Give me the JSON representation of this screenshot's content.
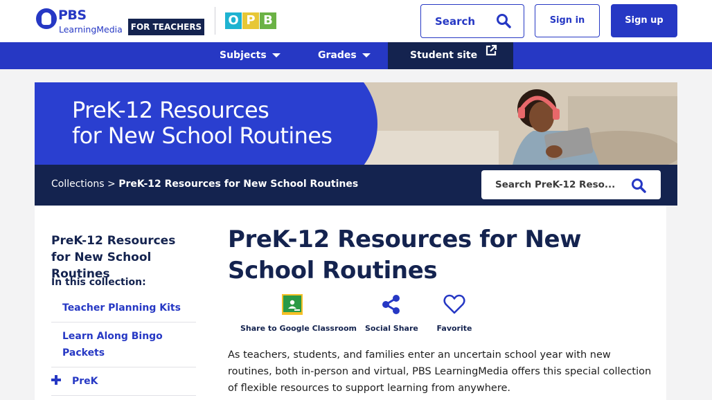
{
  "header": {
    "logo_primary": "PBS",
    "logo_secondary": "LearningMedia",
    "audience_badge": "FOR TEACHERS",
    "station_logo": [
      "O",
      "P",
      "B"
    ],
    "search_label": "Search",
    "signin_label": "Sign in",
    "signup_label": "Sign up"
  },
  "nav": {
    "subjects": "Subjects",
    "grades": "Grades",
    "student_site": "Student site"
  },
  "banner": {
    "title_line1": "PreK-12 Resources",
    "title_line2": "for New School Routines"
  },
  "breadcrumb": {
    "root": "Collections",
    "separator": ">",
    "current": "PreK-12 Resources for New School Routines"
  },
  "collection_search": {
    "placeholder": "Search PreK-12 Reso..."
  },
  "sidebar": {
    "title": "PreK-12 Resources for New School Routines",
    "subtitle": "In this collection:",
    "items": [
      {
        "label": "Teacher Planning Kits"
      },
      {
        "label": "Learn Along Bingo Packets"
      },
      {
        "label": "PreK"
      }
    ]
  },
  "main": {
    "title": "PreK-12 Resources for New School Routines",
    "actions": {
      "google_classroom": "Share to Google Classroom",
      "social_share": "Social Share",
      "favorite": "Favorite"
    },
    "description": "As teachers, students, and families enter an uncertain school year with new routines, both in-person and virtual, PBS LearningMedia offers this special collection of flexible resources to support learning from anywhere."
  },
  "colors": {
    "brand_blue": "#2638c4",
    "navy": "#14234f",
    "opb_cyan": "#1fb3d1",
    "opb_yellow": "#e7c736",
    "opb_green": "#6bb245",
    "classroom_green": "#2a9a46"
  }
}
